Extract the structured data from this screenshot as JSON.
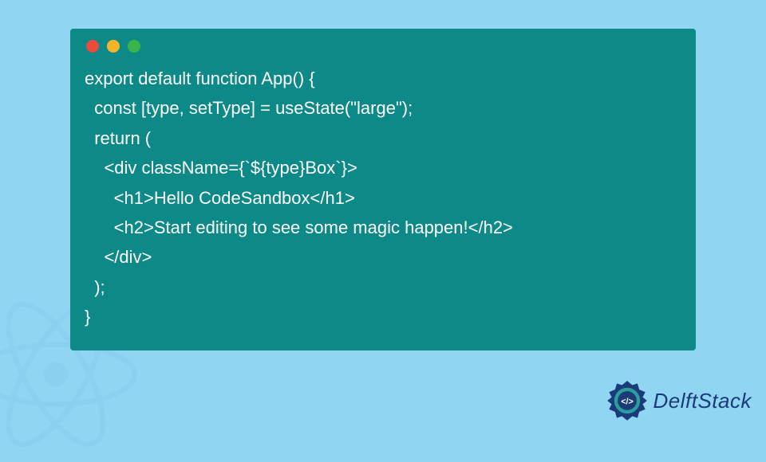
{
  "window": {
    "dots": [
      "red",
      "yellow",
      "green"
    ]
  },
  "code": {
    "lines": [
      "export default function App() {",
      "  const [type, setType] = useState(\"large\");",
      "  return (",
      "    <div className={`${type}Box`}>",
      "      <h1>Hello CodeSandbox</h1>",
      "      <h2>Start editing to see some magic happen!</h2>",
      "    </div>",
      "  );",
      "}"
    ]
  },
  "branding": {
    "name": "DelftStack"
  },
  "colors": {
    "background": "#90d5f2",
    "codeWindow": "#0d8988",
    "codeText": "#ffffff",
    "logoText": "#1a3a78"
  }
}
